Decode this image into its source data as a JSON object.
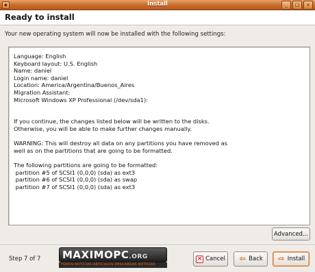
{
  "window": {
    "title": "Install",
    "controls": [
      "minimize-icon",
      "maximize-icon",
      "close-icon"
    ]
  },
  "header": {
    "title": "Ready to install"
  },
  "intro": "Your new operating system will now be installed with the following settings:",
  "summary": {
    "lines": [
      "Language: English",
      "Keyboard layout: U.S. English",
      "Name: daniel",
      "Login name: daniel",
      "Location: America/Argentina/Buenos_Aires",
      "Migration Assistant:",
      "Microsoft Windows XP Professional (/dev/sda1):",
      "",
      "",
      "If you continue, the changes listed below will be written to the disks.",
      "Otherwise, you will be able to make further changes manually.",
      "",
      "WARNING: This will destroy all data on any partitions you have removed as",
      "well as on the partitions that are going to be formatted.",
      "",
      "The following partitions are going to be formatted:",
      " partition #5 of SCSI1 (0,0,0) (sda) as ext3",
      " partition #6 of SCSI1 (0,0,0) (sda) as swap",
      " partition #7 of SCSI1 (0,0,0) (sda) as ext3"
    ]
  },
  "buttons": {
    "advanced": "Advanced...",
    "cancel": "Cancel",
    "back": "Back",
    "install": "Install"
  },
  "footer": {
    "step": "Step 7 of 7"
  },
  "watermark": {
    "main": "MAXIMOPC",
    "suffix": ".ORG",
    "tagline": "FOROS NOTICIAS ARTICULOS DESCARGAS NOTICIAS"
  },
  "colors": {
    "titlebar": "#c86a2a",
    "accent": "#e86a1a",
    "cancel_icon": "#c62020"
  }
}
